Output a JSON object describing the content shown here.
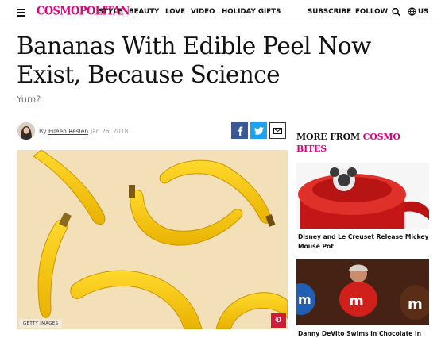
{
  "header": {
    "logo": "COSMOPOLITAN",
    "nav": [
      "STYLE",
      "BEAUTY",
      "LOVE",
      "VIDEO",
      "HOLIDAY GIFTS"
    ],
    "subscribe": "SUBSCRIBE",
    "follow": "FOLLOW",
    "region": "US"
  },
  "article": {
    "headline": "Bananas With Edible Peel Now Exist, Because Science",
    "dek": "Yum?",
    "by": "By",
    "author": "Eileen Reslen",
    "date": "Jan 26, 2018",
    "image_credit": "GETTY IMAGES"
  },
  "share": {
    "facebook": "f",
    "twitter": "t",
    "email": "email-icon"
  },
  "sidebar": {
    "heading_prefix": "MORE FROM ",
    "heading_accent_1": "COSMO",
    "heading_accent_2": "BITES",
    "items": [
      {
        "title": "Disney and Le Creuset Release Mickey Mouse Pot"
      },
      {
        "title": "Danny DeVito Swims in Chocolate in"
      }
    ]
  },
  "colors": {
    "brand": "#e6007e",
    "facebook": "#3b5998",
    "twitter": "#1da1f2",
    "pinterest": "#cf1a39"
  }
}
